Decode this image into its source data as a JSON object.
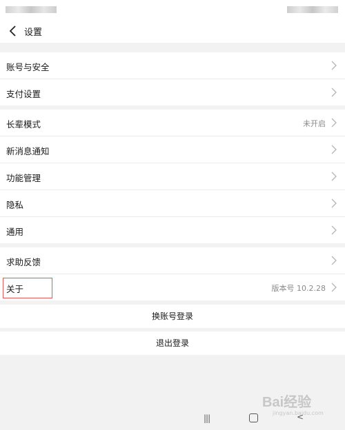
{
  "header": {
    "title": "设置"
  },
  "sections": [
    {
      "items": [
        {
          "label": "账号与安全",
          "value": ""
        },
        {
          "label": "支付设置",
          "value": ""
        }
      ]
    },
    {
      "items": [
        {
          "label": "长辈模式",
          "value": "未开启"
        },
        {
          "label": "新消息通知",
          "value": ""
        },
        {
          "label": "功能管理",
          "value": ""
        },
        {
          "label": "隐私",
          "value": ""
        },
        {
          "label": "通用",
          "value": ""
        }
      ]
    },
    {
      "items": [
        {
          "label": "求助反馈",
          "value": ""
        },
        {
          "label": "关于",
          "value": "版本号 10.2.28"
        }
      ]
    }
  ],
  "actions": {
    "switch_account": "换账号登录",
    "logout": "退出登录"
  },
  "navbar": {
    "recent_glyph": "|||",
    "back_glyph": "<"
  },
  "watermark": {
    "logo": "Bai经验",
    "url": "jingyan.baidu.com"
  },
  "colors": {
    "highlight": "#e15a5a",
    "background": "#f2f2f2"
  }
}
